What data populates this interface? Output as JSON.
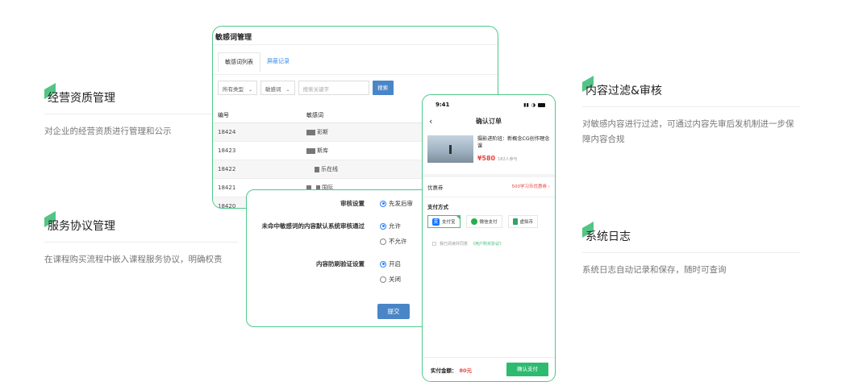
{
  "features": [
    {
      "title": "经营资质管理",
      "desc": "对企业的经营资质进行管理和公示"
    },
    {
      "title": "服务协议管理",
      "desc": "在课程购买流程中嵌入课程服务协议，明确权责"
    },
    {
      "title": "内容过滤&审核",
      "desc": "对敏感内容进行过滤，可通过内容先审后发机制进一步保障内容合规"
    },
    {
      "title": "系统日志",
      "desc": "系统日志自动记录和保存，随时可查询"
    }
  ],
  "sensitive_panel": {
    "title": "敏感词管理",
    "tabs": [
      "敏感词列表",
      "屏蔽记录"
    ],
    "filter_type": "所有类型",
    "filter_field": "敏感词",
    "search_placeholder": "搜索关键字",
    "search_button": "搜索",
    "columns": [
      "编号",
      "敏感词"
    ],
    "rows": [
      {
        "id": "18424",
        "word": "彩斯"
      },
      {
        "id": "18423",
        "word": "斯库"
      },
      {
        "id": "18422",
        "word": "乐在线"
      },
      {
        "id": "18421",
        "word": "国际"
      },
      {
        "id": "18420",
        "word": ""
      }
    ]
  },
  "settings_panel": {
    "audit_label": "审核设置",
    "audit_option": "先发后审",
    "miss_label": "未命中敏感词的内容默认系统审核通过",
    "miss_options": [
      "允许",
      "不允许"
    ],
    "flood_label": "内容防刷验证设置",
    "flood_options": [
      "开启",
      "关闭"
    ],
    "submit": "提交"
  },
  "phone": {
    "time": "9:41",
    "title": "确认订单",
    "course_title": "摄影进阶班：新概念CG创作理念课",
    "price": "¥580",
    "buyers": "182人参与",
    "coupon_label": "优惠券",
    "coupon_value": "500学习币优惠券",
    "pay_label": "支付方式",
    "pay_methods": [
      "支付宝",
      "微信支付",
      "虚拟币"
    ],
    "agree_text": "我已阅读并同意",
    "agree_link": "《用户购买协议》",
    "total_label": "实付金额：",
    "total_value": "80元",
    "confirm": "确认支付"
  }
}
